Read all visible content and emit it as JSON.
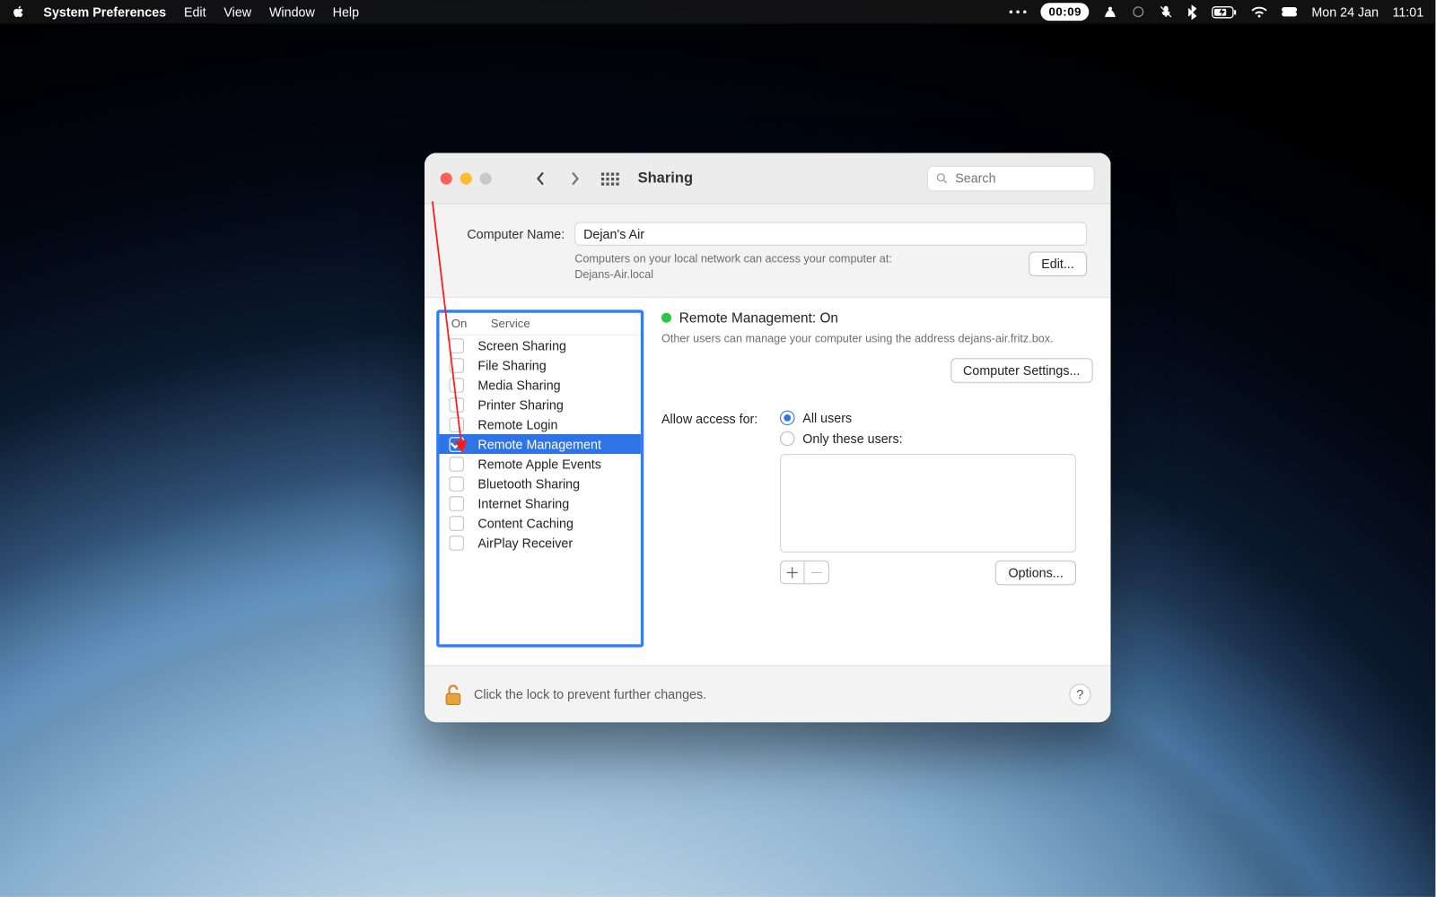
{
  "menubar": {
    "app": "System Preferences",
    "items": [
      "Edit",
      "View",
      "Window",
      "Help"
    ],
    "timer_pill": "00:09",
    "date": "Mon 24 Jan",
    "clock": "11:01"
  },
  "window": {
    "title": "Sharing",
    "search_placeholder": "Search",
    "computer_name_label": "Computer Name:",
    "computer_name": "Dejan's Air",
    "hint_line1": "Computers on your local network can access your computer at:",
    "hint_line2": "Dejans-Air.local",
    "edit_btn": "Edit...",
    "services_header": {
      "on": "On",
      "service": "Service"
    },
    "services": [
      {
        "name": "Screen Sharing",
        "on": false
      },
      {
        "name": "File Sharing",
        "on": false
      },
      {
        "name": "Media Sharing",
        "on": false
      },
      {
        "name": "Printer Sharing",
        "on": false
      },
      {
        "name": "Remote Login",
        "on": false
      },
      {
        "name": "Remote Management",
        "on": true,
        "selected": true
      },
      {
        "name": "Remote Apple Events",
        "on": false
      },
      {
        "name": "Bluetooth Sharing",
        "on": false
      },
      {
        "name": "Internet Sharing",
        "on": false
      },
      {
        "name": "Content Caching",
        "on": false
      },
      {
        "name": "AirPlay Receiver",
        "on": false
      }
    ],
    "status_title": "Remote Management: On",
    "status_desc": "Other users can manage your computer using the address dejans-air.fritz.box.",
    "computer_settings_btn": "Computer Settings...",
    "access_label": "Allow access for:",
    "access_all": "All users",
    "access_only": "Only these users:",
    "options_btn": "Options...",
    "lock_text": "Click the lock to prevent further changes.",
    "help": "?"
  }
}
